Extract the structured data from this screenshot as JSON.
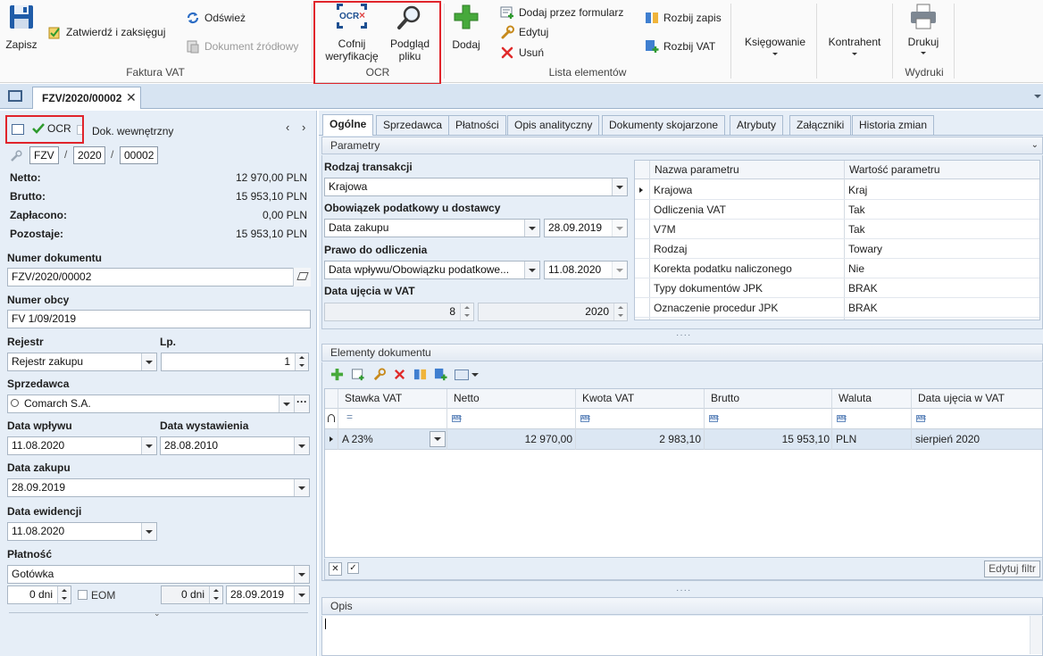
{
  "ribbon": {
    "save_label": "Zapisz",
    "confirm_label": "Zatwierdź i zaksięguj",
    "refresh_label": "Odśwież",
    "source_doc_label": "Dokument źródłowy",
    "group_invoice": "Faktura VAT",
    "ocr_icon_text": "OCR",
    "undo_verify_label_1": "Cofnij",
    "undo_verify_label_2": "weryfikację",
    "preview_label_1": "Podgląd",
    "preview_label_2": "pliku",
    "group_ocr": "OCR",
    "add_label": "Dodaj",
    "add_form_label": "Dodaj przez formularz",
    "edit_label": "Edytuj",
    "delete_label": "Usuń",
    "split_entry_label": "Rozbij zapis",
    "split_vat_label": "Rozbij VAT",
    "group_list": "Lista elementów",
    "booking_label": "Księgowanie",
    "contractor_label": "Kontrahent",
    "print_label": "Drukuj",
    "group_prints": "Wydruki"
  },
  "doc_tab": {
    "title": "FZV/2020/00002"
  },
  "left": {
    "ocr_badge": "OCR",
    "internal_doc": "Dok. wewnętrzny",
    "number_parts": [
      "FZV",
      "2020",
      "00002"
    ],
    "summary": [
      {
        "label": "Netto:",
        "value": "12 970,00 PLN"
      },
      {
        "label": "Brutto:",
        "value": "15 953,10 PLN"
      },
      {
        "label": "Zapłacono:",
        "value": "0,00 PLN"
      },
      {
        "label": "Pozostaje:",
        "value": "15 953,10 PLN"
      }
    ],
    "doc_number_label": "Numer dokumentu",
    "doc_number_value": "FZV/2020/00002",
    "foreign_number_label": "Numer obcy",
    "foreign_number_value": "FV 1/09/2019",
    "register_label": "Rejestr",
    "register_value": "Rejestr zakupu",
    "lp_label": "Lp.",
    "lp_value": "1",
    "seller_label": "Sprzedawca",
    "seller_value": "Comarch S.A.",
    "receipt_date_label": "Data wpływu",
    "receipt_date_value": "11.08.2020",
    "issue_date_label": "Data wystawienia",
    "issue_date_value": "28.08.2010",
    "purchase_date_label": "Data zakupu",
    "purchase_date_value": "28.09.2019",
    "record_date_label": "Data ewidencji",
    "record_date_value": "11.08.2020",
    "payment_label": "Płatność",
    "payment_value": "Gotówka",
    "days_value": "0 dni",
    "eom_label": "EOM",
    "days_value_2": "0 dni",
    "payment_date_value": "28.09.2019"
  },
  "tabs": [
    "Ogólne",
    "Sprzedawca",
    "Płatności",
    "Opis analityczny",
    "Dokumenty skojarzone",
    "Atrybuty",
    "Załączniki",
    "Historia zmian"
  ],
  "params": {
    "section_title": "Parametry",
    "transaction_type_label": "Rodzaj transakcji",
    "transaction_type_value": "Krajowa",
    "tax_obligation_label": "Obowiązek podatkowy u dostawcy",
    "tax_obligation_value": "Data zakupu",
    "tax_obligation_date": "28.09.2019",
    "deduction_label": "Prawo do odliczenia",
    "deduction_value": "Data wpływu/Obowiązku podatkowe...",
    "deduction_date": "11.08.2020",
    "vat_date_label": "Data ujęcia w VAT",
    "vat_month": "8",
    "vat_year": "2020",
    "grid_headers": [
      "Nazwa parametru",
      "Wartość parametru"
    ],
    "grid_rows": [
      [
        "Krajowa",
        "Kraj"
      ],
      [
        "Odliczenia VAT",
        "Tak"
      ],
      [
        "V7M",
        "Tak"
      ],
      [
        "Rodzaj",
        "Towary"
      ],
      [
        "Korekta podatku naliczonego",
        "Nie"
      ],
      [
        "Typy dokumentów JPK",
        "BRAK"
      ],
      [
        "Oznaczenie procedur JPK",
        "BRAK"
      ]
    ]
  },
  "elements": {
    "section_title": "Elementy dokumentu",
    "headers": [
      "Stawka VAT",
      "Netto",
      "Kwota VAT",
      "Brutto",
      "Waluta",
      "Data ujęcia w VAT"
    ],
    "filter_op": "=",
    "filter_abc": "ABC",
    "rows": [
      [
        "A 23%",
        "12 970,00",
        "2 983,10",
        "15 953,10",
        "PLN",
        "sierpień 2020"
      ]
    ],
    "edit_filter_label": "Edytuj filtr"
  },
  "desc": {
    "section_title": "Opis"
  },
  "colors": {
    "highlight": "#e0242b",
    "accent_green": "#2e9a2e",
    "panel_bg": "#e6eef7"
  }
}
